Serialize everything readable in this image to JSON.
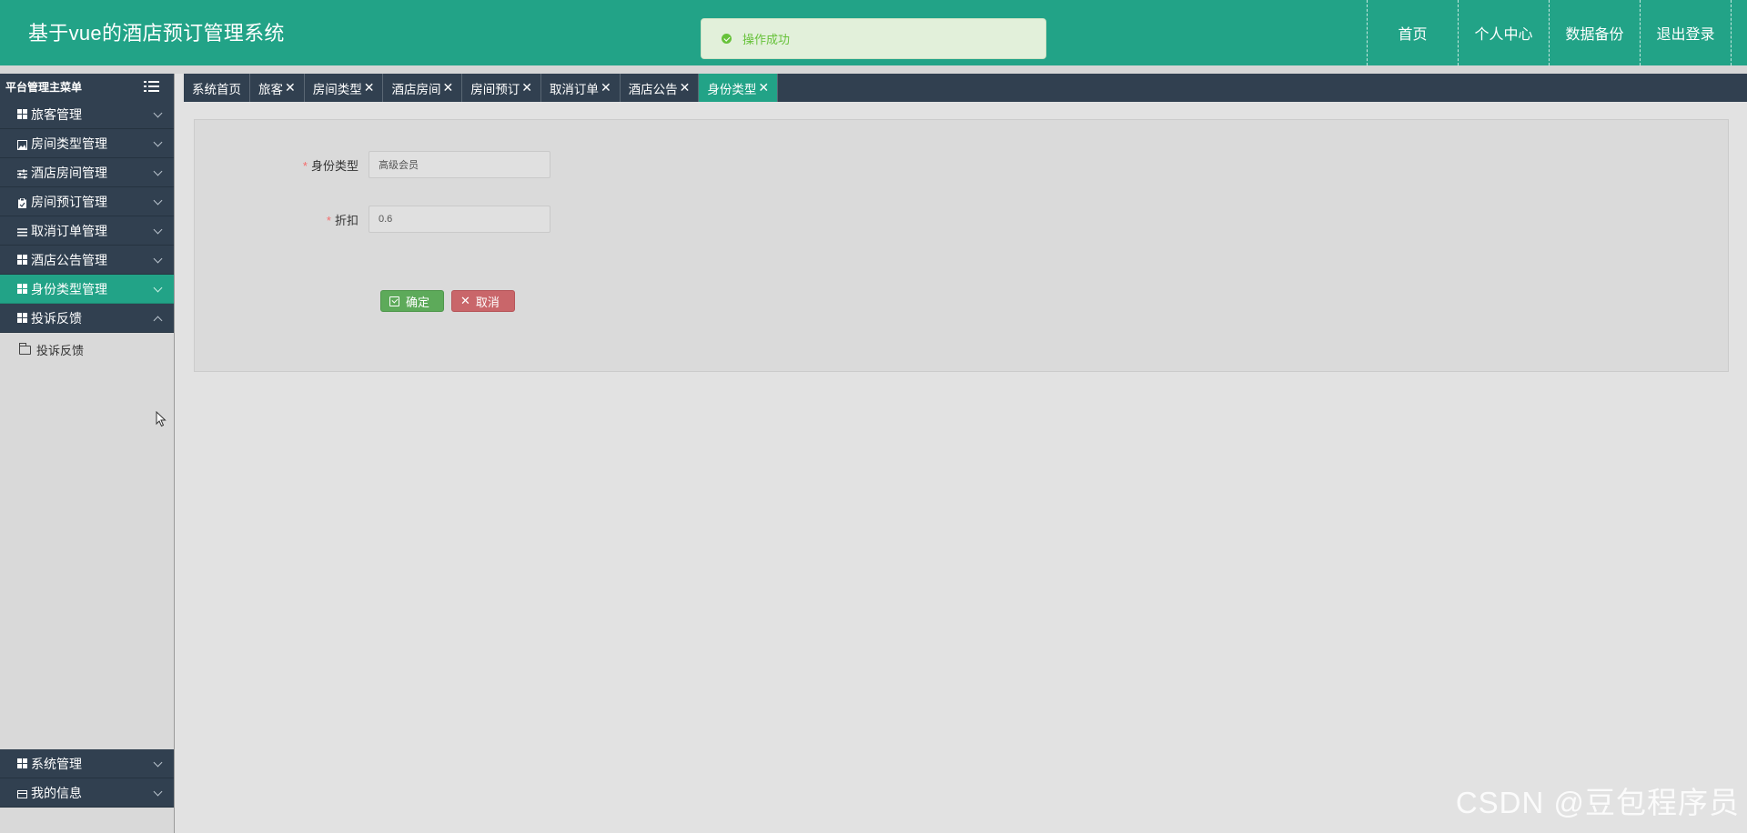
{
  "header": {
    "title": "基于vue的酒店预订管理系统",
    "nav": [
      "首页",
      "个人中心",
      "数据备份",
      "退出登录"
    ]
  },
  "toast": {
    "message": "操作成功",
    "type": "success"
  },
  "sidebar": {
    "title": "平台管理主菜单",
    "items": [
      {
        "label": "旅客管理",
        "icon": "grid-icon"
      },
      {
        "label": "房间类型管理",
        "icon": "image-icon"
      },
      {
        "label": "酒店房间管理",
        "icon": "sliders-icon"
      },
      {
        "label": "房间预订管理",
        "icon": "clipboard-icon"
      },
      {
        "label": "取消订单管理",
        "icon": "list-icon"
      },
      {
        "label": "酒店公告管理",
        "icon": "grid-icon"
      },
      {
        "label": "身份类型管理",
        "icon": "grid-icon",
        "active": true
      },
      {
        "label": "投诉反馈",
        "icon": "grid-icon",
        "expanded": true
      }
    ],
    "submenu": [
      {
        "label": "投诉反馈",
        "icon": "folder-icon"
      }
    ],
    "bottom_items": [
      {
        "label": "系统管理",
        "icon": "grid-icon"
      },
      {
        "label": "我的信息",
        "icon": "card-icon"
      }
    ]
  },
  "tabs": [
    {
      "label": "系统首页",
      "closable": false
    },
    {
      "label": "旅客",
      "closable": true
    },
    {
      "label": "房间类型",
      "closable": true
    },
    {
      "label": "酒店房间",
      "closable": true
    },
    {
      "label": "房间预订",
      "closable": true
    },
    {
      "label": "取消订单",
      "closable": true
    },
    {
      "label": "酒店公告",
      "closable": true
    },
    {
      "label": "身份类型",
      "closable": true,
      "active": true
    }
  ],
  "tab_close_glyph": "✕",
  "form": {
    "fields": [
      {
        "label": "身份类型",
        "value": "高级会员",
        "required": true
      },
      {
        "label": "折扣",
        "value": "0.6",
        "required": true
      }
    ],
    "required_mark": "*",
    "confirm_label": "确定",
    "cancel_label": "取消",
    "cancel_glyph": "✕"
  },
  "watermark": "CSDN @豆包程序员",
  "colors": {
    "primary": "#22a387",
    "sidebar_dark": "#314050",
    "success": "#67c23a",
    "confirm": "#5daa5a",
    "cancel": "#c9666a"
  }
}
